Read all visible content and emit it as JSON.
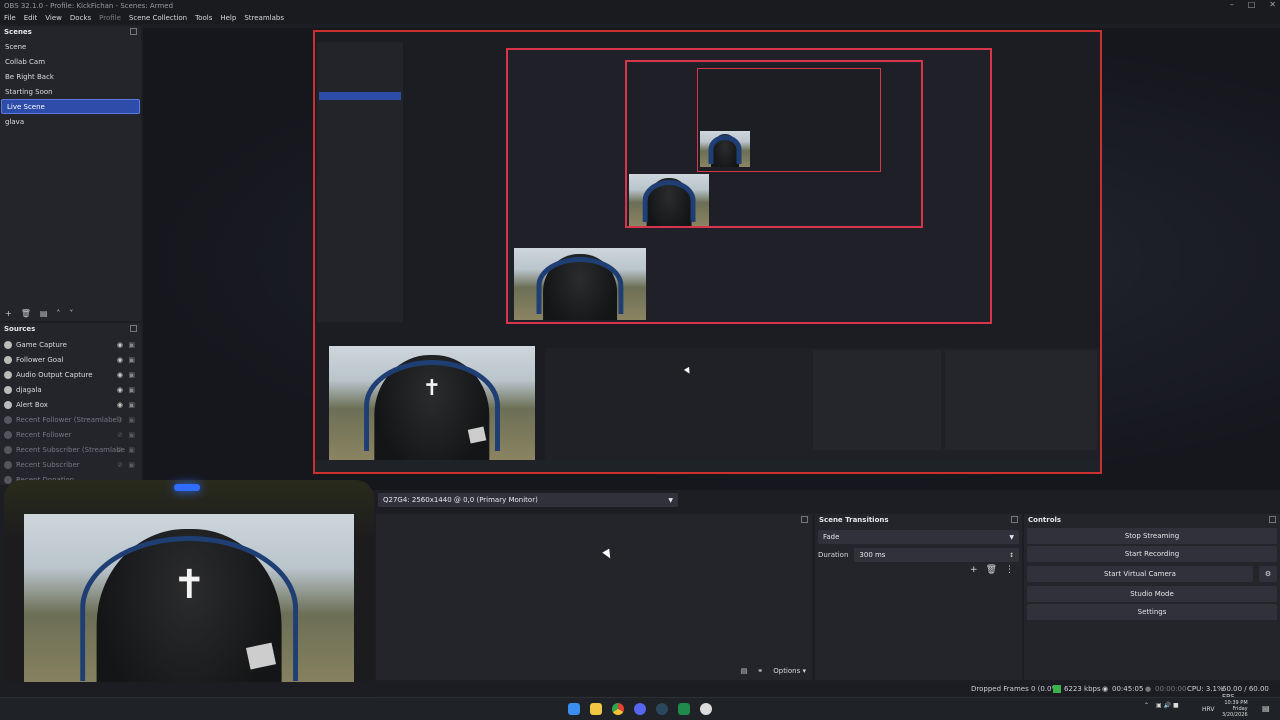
{
  "window": {
    "title": "OBS 32.1.0 - Profile: KickFichan - Scenes: Armed"
  },
  "menu": [
    "File",
    "Edit",
    "View",
    "Docks",
    "Profile",
    "Scene Collection",
    "Tools",
    "Help",
    "Streamlabs"
  ],
  "scenes": {
    "title": "Scenes",
    "items": [
      "Scene",
      "Collab Cam",
      "Be Right Back",
      "Starting Soon",
      "Live Scene",
      "glava"
    ],
    "selected": "Live Scene"
  },
  "sources": {
    "title": "Sources",
    "items": [
      {
        "label": "Game Capture",
        "visible": true
      },
      {
        "label": "Follower Goal",
        "visible": true
      },
      {
        "label": "Audio Output Capture",
        "visible": true
      },
      {
        "label": "djagala",
        "visible": true
      },
      {
        "label": "Alert Box",
        "visible": true
      },
      {
        "label": "Recent Follower (Streamlabel)",
        "visible": false
      },
      {
        "label": "Recent Follower",
        "visible": false
      },
      {
        "label": "Recent Subscriber (Streamlabe",
        "visible": false
      },
      {
        "label": "Recent Subscriber",
        "visible": false
      },
      {
        "label": "Recent Donation",
        "visible": false
      }
    ]
  },
  "display_select": {
    "value": "Q27G4: 2560x1440 @ 0,0 (Primary Monitor)"
  },
  "scene_transitions": {
    "title": "Scene Transitions",
    "transition": "Fade",
    "duration_label": "Duration",
    "duration_value": "300 ms"
  },
  "controls": {
    "title": "Controls",
    "stop_streaming": "Stop Streaming",
    "start_recording": "Start Recording",
    "start_virtual_camera": "Start Virtual Camera",
    "studio_mode": "Studio Mode",
    "settings": "Settings"
  },
  "mixer": {
    "options_label": "Options"
  },
  "status": {
    "dropped_frames": "Dropped Frames 0 (0.0%)",
    "bitrate": "6223 kbps",
    "live_time": "00:45:05",
    "rec_time": "00:00:00",
    "cpu": "CPU: 3.1%",
    "fps": "60.00 / 60.00 FPS"
  },
  "taskbar": {
    "lang": "HRV",
    "time": "10:39 PM",
    "day": "Friday",
    "date": "3/20/2026"
  },
  "colors": {
    "accent": "#2e4dab",
    "preview_border": "#c9302f",
    "panel_bg": "#24252b"
  }
}
